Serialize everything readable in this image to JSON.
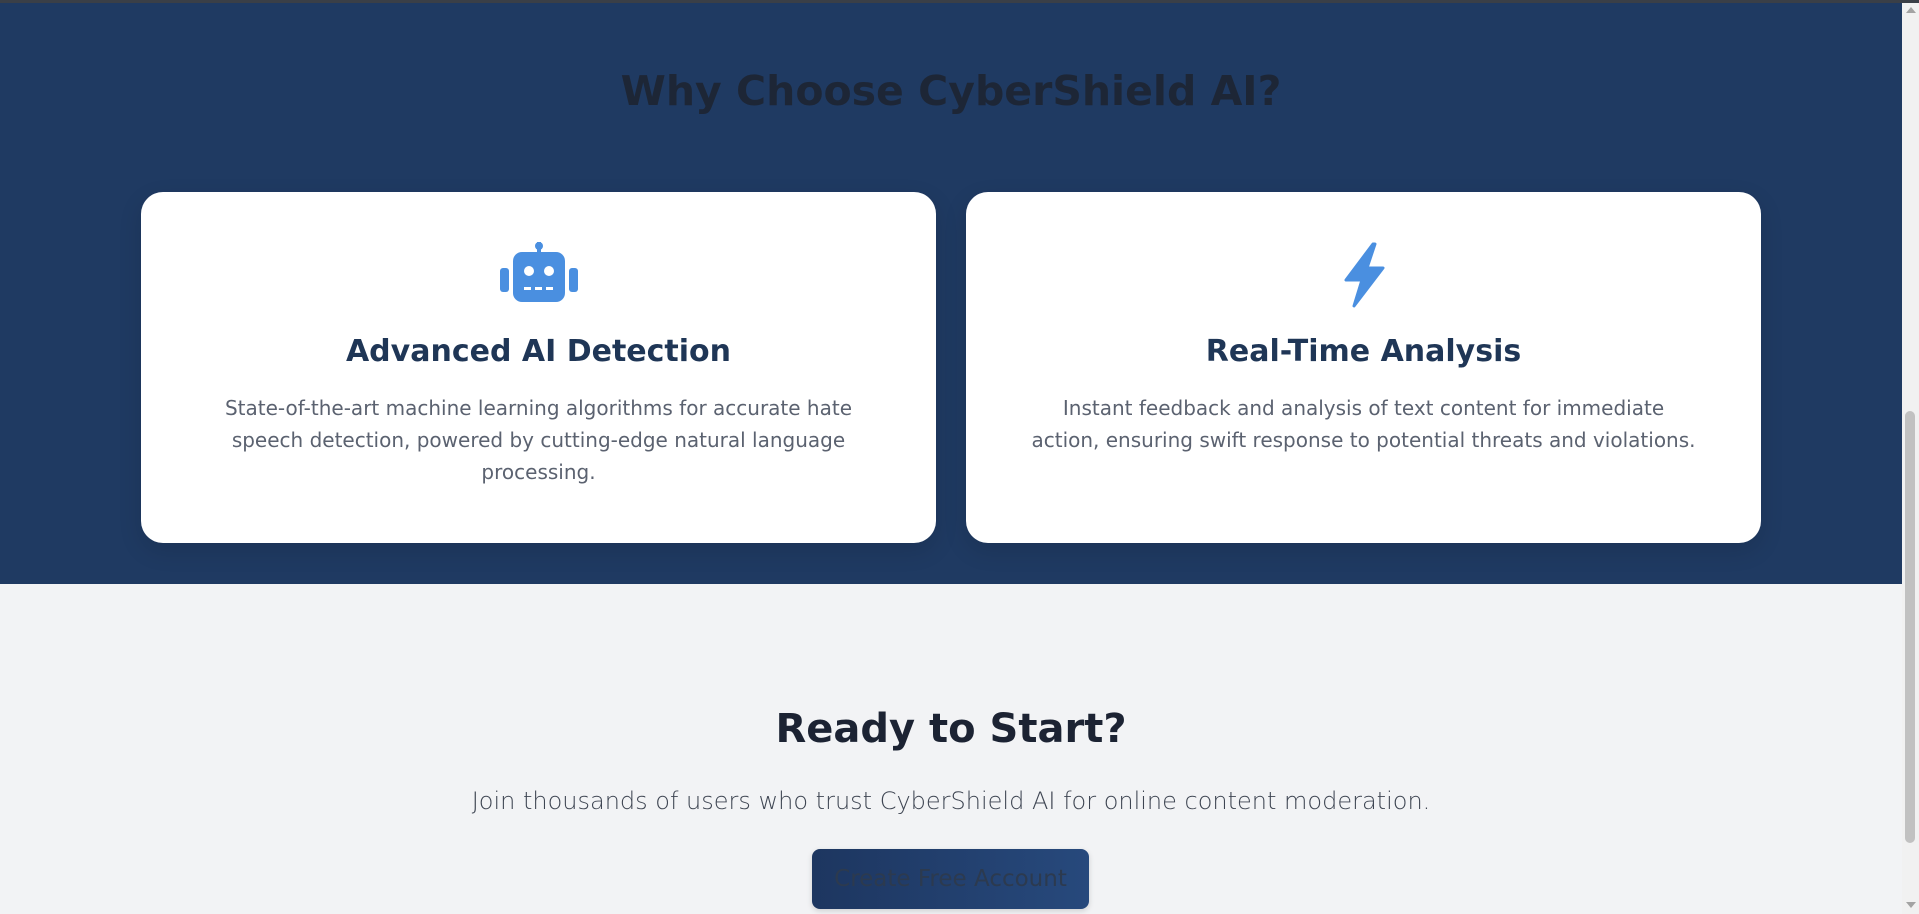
{
  "features": {
    "title": "Why Choose CyberShield AI?",
    "cards": [
      {
        "icon": "robot-icon",
        "title": "Advanced AI Detection",
        "description": "State-of-the-art machine learning algorithms for accurate hate speech detection, powered by cutting-edge natural language processing."
      },
      {
        "icon": "lightning-bolt-icon",
        "title": "Real-Time Analysis",
        "description": "Instant feedback and analysis of text content for immediate action, ensuring swift response to potential threats and violations."
      }
    ]
  },
  "cta": {
    "title": "Ready to Start?",
    "text": "Join thousands of users who trust CyberShield AI for online content moderation.",
    "button_label": "Create Free Account"
  },
  "colors": {
    "section_background": "#1f3a62",
    "icon_accent": "#4a8fe0",
    "card_title": "#1f3656",
    "page_background": "#f2f3f5"
  }
}
